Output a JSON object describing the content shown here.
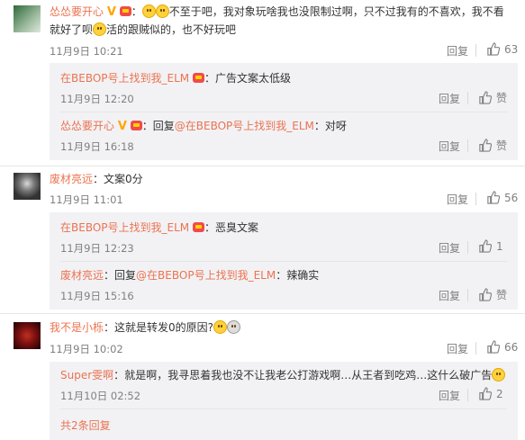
{
  "labels": {
    "reply": "回复",
    "like": "赞",
    "colon": "：",
    "reply_prefix": "回复",
    "at": "@"
  },
  "comments": [
    {
      "user": "怂怂要开心",
      "text_part1": "不至于吧，我对象玩啥我也没限制过啊，只不过我有的不喜欢，我不看",
      "text_part2_a": "就好了呗",
      "text_part2_b": "活的跟贼似的，也不好玩吧",
      "time": "11月9日 10:21",
      "likes": "63"
    },
    {
      "user": "废材亮远",
      "text": "文案0分",
      "time": "11月9日 11:01",
      "likes": "56"
    },
    {
      "user": "我不是小栎",
      "text": "这就是转发0的原因?",
      "time": "11月9日 10:02",
      "likes": "66"
    }
  ],
  "replies": [
    {
      "user": "在BEBOP号上找到我_ELM",
      "text": "广告文案太低级",
      "time": "11月9日 12:20",
      "likes": "赞"
    },
    {
      "user": "怂怂要开心",
      "target": "在BEBOP号上找到我_ELM",
      "text": "对呀",
      "time": "11月9日 16:18",
      "likes": "赞"
    },
    {
      "user": "在BEBOP号上找到我_ELM",
      "text": "恶臭文案",
      "time": "11月9日 12:23",
      "likes": "1"
    },
    {
      "user": "废材亮远",
      "target": "在BEBOP号上找到我_ELM",
      "text": "辣确实",
      "time": "11月9日 15:16",
      "likes": "赞"
    },
    {
      "user": "Super雯啊",
      "text": "就是啊，我寻思着我也没不让我老公打游戏啊…从王者到吃鸡…这什么破广告",
      "time": "11月10日 02:52",
      "likes": "2"
    }
  ],
  "more_replies": "共2条回复",
  "colors": {
    "link": "#eb7350",
    "subbox": "#f2f2f5",
    "meta": "#808080"
  }
}
